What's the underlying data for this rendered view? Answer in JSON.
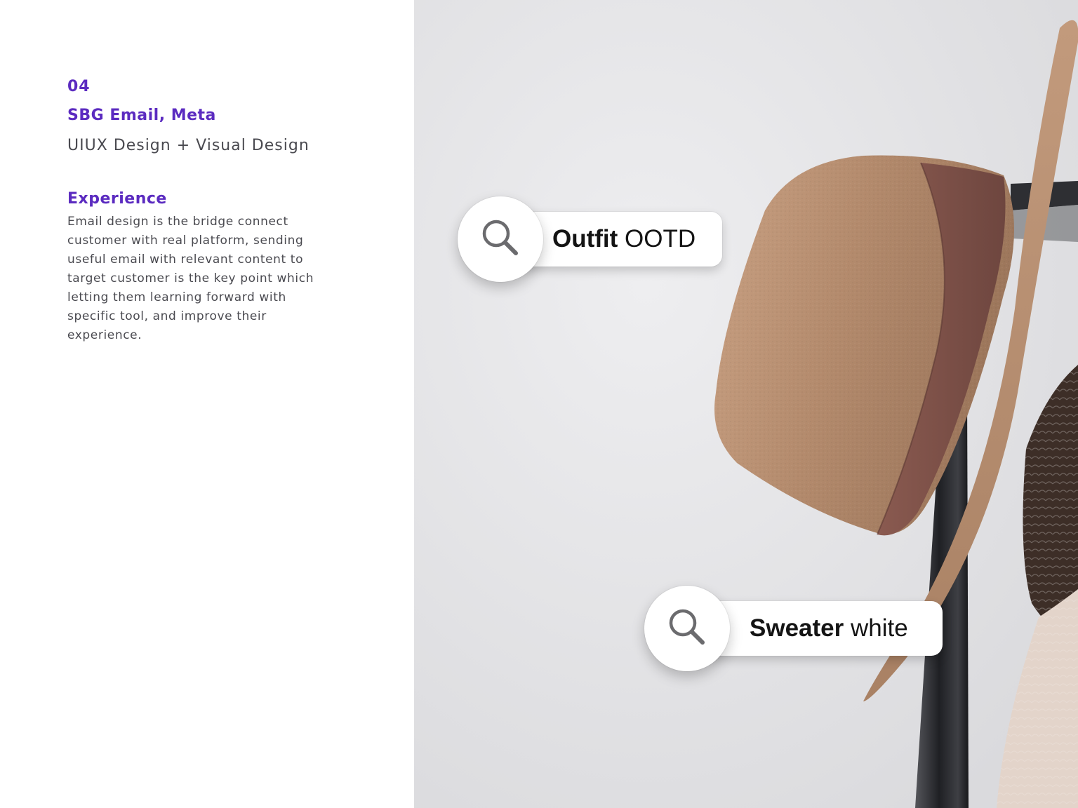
{
  "project": {
    "number": "04",
    "title": "SBG Email, Meta",
    "subtitle": "UIUX Design + Visual Design"
  },
  "experience": {
    "heading": "Experience",
    "body": "Email design is the bridge connect customer with real platform, sending useful email with relevant content to target customer is the key point which letting them learning forward with specific tool, and improve their experience."
  },
  "search_chips": [
    {
      "icon": "search-icon",
      "bold": "Outfit",
      "rest": " OOTD"
    },
    {
      "icon": "search-icon",
      "bold": "Sweater",
      "rest": " white"
    }
  ],
  "colors": {
    "accent": "#5b2bc0",
    "body_text": "#4a4a50",
    "photo_background": "#e6e6e9",
    "hat": "#b0876a",
    "hat_band": "#7c4f46",
    "sweater_dark": "#3f3029",
    "sweater_light": "#e2d3c9",
    "rack_metal": "#2c2d31"
  }
}
